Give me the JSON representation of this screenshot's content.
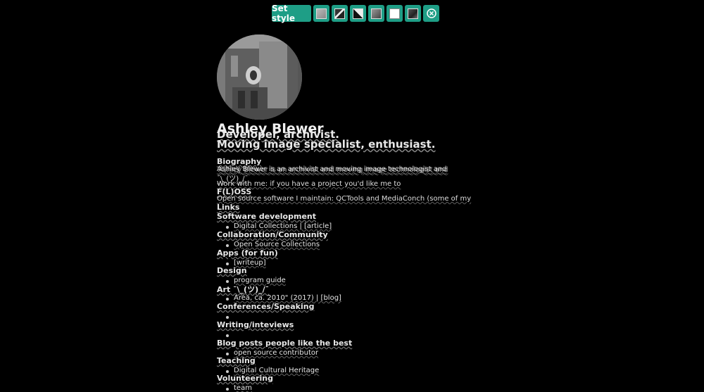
{
  "toolbar": {
    "set_style_label": "Set style",
    "icons": [
      "style-thumb-1",
      "style-thumb-2",
      "style-thumb-3",
      "style-thumb-4",
      "style-thumb-5",
      "style-thumb-6",
      "close-icon"
    ],
    "accent": "#1e9e86"
  },
  "profile": {
    "name": "Ashley Blewer",
    "tagline_1": "Developer, archivist.",
    "tagline_2": "Moving image specialist, enthusiast."
  },
  "sections": {
    "biography": {
      "heading": "Biography",
      "line_1": "Ashley Blewer is an archivist and moving image technologist and",
      "line_2": "¯\\_(ツ)_/¯",
      "line_3": "Work with me: if you have a project you'd like me to",
      "heading_floss": "F(L)OSS",
      "line_4": "Open source software I maintain: QCTools and MediaConch (some of my"
    },
    "links_heading": "Links",
    "software": {
      "heading": "Software development",
      "item": "Digital Collections | [article]"
    },
    "collaboration": {
      "heading": "Collaboration/Community",
      "item": "Open Source Collections"
    },
    "apps": {
      "heading": "Apps (for fun)",
      "item": "[writeup]"
    },
    "design": {
      "heading": "Design",
      "item": "program guide"
    },
    "art": {
      "heading": "Art ¯\\_(ツ)_/¯",
      "item": "Area, ca. 2010\" (2017) | [blog]"
    },
    "conferences": {
      "heading": "Conferences/Speaking",
      "item": ""
    },
    "writing": {
      "heading": "Writing/inteviews",
      "item": ""
    },
    "blog": {
      "heading": "Blog posts people like the best",
      "item": "open source contributor"
    },
    "teaching": {
      "heading": "Teaching",
      "item": "Digital Cultural Heritage"
    },
    "volunteering": {
      "heading": "Volunteering",
      "item": "team"
    }
  }
}
